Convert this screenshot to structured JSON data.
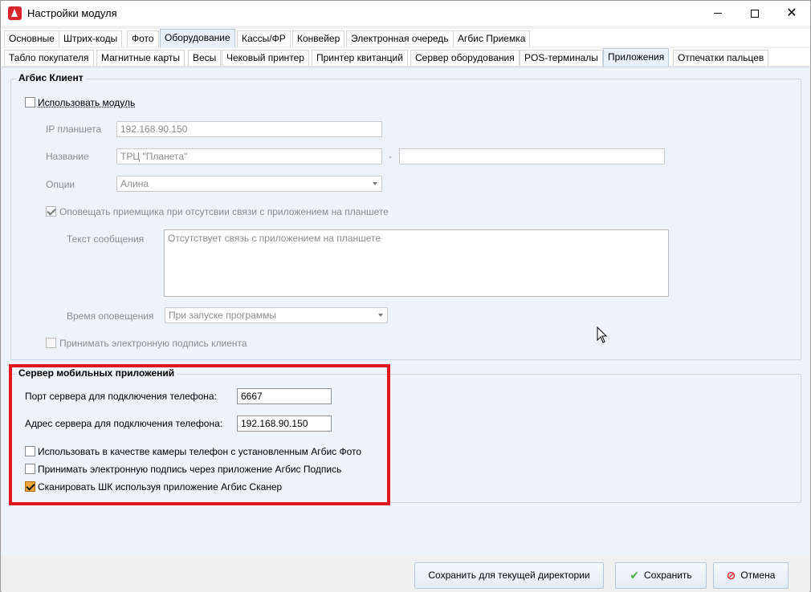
{
  "window": {
    "title": "Настройки модуля"
  },
  "tabs_top": [
    {
      "label": "Основные"
    },
    {
      "label": "Штрих-коды"
    },
    {
      "label": "Фото"
    },
    {
      "label": "Оборудование"
    },
    {
      "label": "Кассы/ФР"
    },
    {
      "label": "Конвейер"
    },
    {
      "label": "Электронная очередь"
    },
    {
      "label": "Агбис Приемка"
    }
  ],
  "tabs_sub": [
    {
      "label": "Табло покупателя"
    },
    {
      "label": "Магнитные карты"
    },
    {
      "label": "Весы"
    },
    {
      "label": "Чековый принтер"
    },
    {
      "label": "Принтер квитанций"
    },
    {
      "label": "Сервер оборудования"
    },
    {
      "label": "POS-терминалы"
    },
    {
      "label": "Приложения"
    },
    {
      "label": "Отпечатки пальцев"
    }
  ],
  "client_group": {
    "title": "Агбис Клиент",
    "use_module_label": "Использовать модуль",
    "use_module_checked": false,
    "ip_label": "IP планшета",
    "ip_value": "192.168.90.150",
    "name_label": "Название",
    "name_value": "ТРЦ \"Планета\"",
    "name_separator": "-",
    "name_value2": "",
    "options_label": "Опции",
    "options_value": "Алина",
    "notify_label": "Оповещать приемщика при отсутсвии связи с приложением на планшете",
    "notify_checked": true,
    "message_label": "Текст сообщения",
    "message_value": "Отсутствует связь с приложением на планшете",
    "time_label": "Время оповещения",
    "time_value": "При запуске программы",
    "signature_label": "Принимать электронную подпись клиента",
    "signature_checked": false
  },
  "server_group": {
    "title": "Сервер мобильных приложений",
    "port_label": "Порт сервера для подключения телефона:",
    "port_value": "6667",
    "address_label": "Адрес сервера для подключения телефона:",
    "address_value": "192.168.90.150",
    "camera_label": "Использовать в качестве камеры телефон с установленным Агбис Фото",
    "camera_checked": false,
    "esign_label": "Принимать электронную подпись через приложение Агбис Подпись",
    "esign_checked": false,
    "scan_label": "Сканировать ШК используя приложение Агбис Сканер",
    "scan_checked": true
  },
  "buttons": {
    "save_dir": "Сохранить для текущей директории",
    "save": "Сохранить",
    "cancel": "Отмена"
  },
  "colors": {
    "highlight": "#e3151d",
    "accent_check": "#f2a537"
  }
}
